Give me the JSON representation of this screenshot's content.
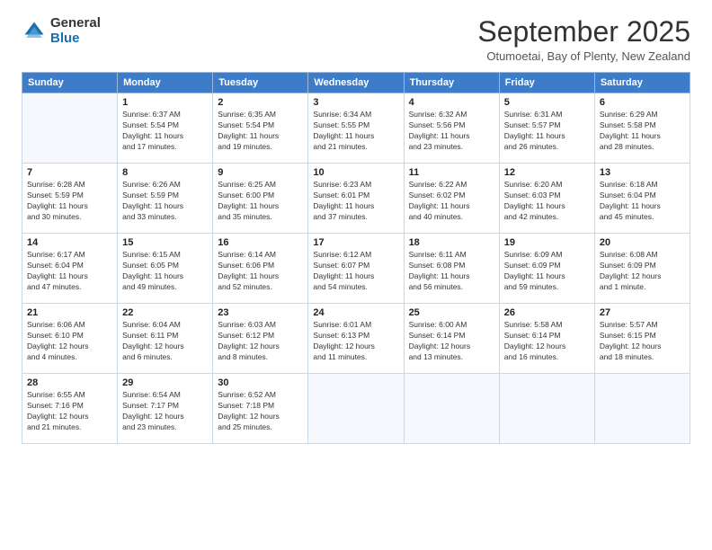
{
  "logo": {
    "line1": "General",
    "line2": "Blue"
  },
  "header": {
    "month": "September 2025",
    "location": "Otumoetai, Bay of Plenty, New Zealand"
  },
  "weekdays": [
    "Sunday",
    "Monday",
    "Tuesday",
    "Wednesday",
    "Thursday",
    "Friday",
    "Saturday"
  ],
  "weeks": [
    [
      {
        "day": "",
        "info": []
      },
      {
        "day": "1",
        "info": [
          "Sunrise: 6:37 AM",
          "Sunset: 5:54 PM",
          "Daylight: 11 hours",
          "and 17 minutes."
        ]
      },
      {
        "day": "2",
        "info": [
          "Sunrise: 6:35 AM",
          "Sunset: 5:54 PM",
          "Daylight: 11 hours",
          "and 19 minutes."
        ]
      },
      {
        "day": "3",
        "info": [
          "Sunrise: 6:34 AM",
          "Sunset: 5:55 PM",
          "Daylight: 11 hours",
          "and 21 minutes."
        ]
      },
      {
        "day": "4",
        "info": [
          "Sunrise: 6:32 AM",
          "Sunset: 5:56 PM",
          "Daylight: 11 hours",
          "and 23 minutes."
        ]
      },
      {
        "day": "5",
        "info": [
          "Sunrise: 6:31 AM",
          "Sunset: 5:57 PM",
          "Daylight: 11 hours",
          "and 26 minutes."
        ]
      },
      {
        "day": "6",
        "info": [
          "Sunrise: 6:29 AM",
          "Sunset: 5:58 PM",
          "Daylight: 11 hours",
          "and 28 minutes."
        ]
      }
    ],
    [
      {
        "day": "7",
        "info": [
          "Sunrise: 6:28 AM",
          "Sunset: 5:59 PM",
          "Daylight: 11 hours",
          "and 30 minutes."
        ]
      },
      {
        "day": "8",
        "info": [
          "Sunrise: 6:26 AM",
          "Sunset: 5:59 PM",
          "Daylight: 11 hours",
          "and 33 minutes."
        ]
      },
      {
        "day": "9",
        "info": [
          "Sunrise: 6:25 AM",
          "Sunset: 6:00 PM",
          "Daylight: 11 hours",
          "and 35 minutes."
        ]
      },
      {
        "day": "10",
        "info": [
          "Sunrise: 6:23 AM",
          "Sunset: 6:01 PM",
          "Daylight: 11 hours",
          "and 37 minutes."
        ]
      },
      {
        "day": "11",
        "info": [
          "Sunrise: 6:22 AM",
          "Sunset: 6:02 PM",
          "Daylight: 11 hours",
          "and 40 minutes."
        ]
      },
      {
        "day": "12",
        "info": [
          "Sunrise: 6:20 AM",
          "Sunset: 6:03 PM",
          "Daylight: 11 hours",
          "and 42 minutes."
        ]
      },
      {
        "day": "13",
        "info": [
          "Sunrise: 6:18 AM",
          "Sunset: 6:04 PM",
          "Daylight: 11 hours",
          "and 45 minutes."
        ]
      }
    ],
    [
      {
        "day": "14",
        "info": [
          "Sunrise: 6:17 AM",
          "Sunset: 6:04 PM",
          "Daylight: 11 hours",
          "and 47 minutes."
        ]
      },
      {
        "day": "15",
        "info": [
          "Sunrise: 6:15 AM",
          "Sunset: 6:05 PM",
          "Daylight: 11 hours",
          "and 49 minutes."
        ]
      },
      {
        "day": "16",
        "info": [
          "Sunrise: 6:14 AM",
          "Sunset: 6:06 PM",
          "Daylight: 11 hours",
          "and 52 minutes."
        ]
      },
      {
        "day": "17",
        "info": [
          "Sunrise: 6:12 AM",
          "Sunset: 6:07 PM",
          "Daylight: 11 hours",
          "and 54 minutes."
        ]
      },
      {
        "day": "18",
        "info": [
          "Sunrise: 6:11 AM",
          "Sunset: 6:08 PM",
          "Daylight: 11 hours",
          "and 56 minutes."
        ]
      },
      {
        "day": "19",
        "info": [
          "Sunrise: 6:09 AM",
          "Sunset: 6:09 PM",
          "Daylight: 11 hours",
          "and 59 minutes."
        ]
      },
      {
        "day": "20",
        "info": [
          "Sunrise: 6:08 AM",
          "Sunset: 6:09 PM",
          "Daylight: 12 hours",
          "and 1 minute."
        ]
      }
    ],
    [
      {
        "day": "21",
        "info": [
          "Sunrise: 6:06 AM",
          "Sunset: 6:10 PM",
          "Daylight: 12 hours",
          "and 4 minutes."
        ]
      },
      {
        "day": "22",
        "info": [
          "Sunrise: 6:04 AM",
          "Sunset: 6:11 PM",
          "Daylight: 12 hours",
          "and 6 minutes."
        ]
      },
      {
        "day": "23",
        "info": [
          "Sunrise: 6:03 AM",
          "Sunset: 6:12 PM",
          "Daylight: 12 hours",
          "and 8 minutes."
        ]
      },
      {
        "day": "24",
        "info": [
          "Sunrise: 6:01 AM",
          "Sunset: 6:13 PM",
          "Daylight: 12 hours",
          "and 11 minutes."
        ]
      },
      {
        "day": "25",
        "info": [
          "Sunrise: 6:00 AM",
          "Sunset: 6:14 PM",
          "Daylight: 12 hours",
          "and 13 minutes."
        ]
      },
      {
        "day": "26",
        "info": [
          "Sunrise: 5:58 AM",
          "Sunset: 6:14 PM",
          "Daylight: 12 hours",
          "and 16 minutes."
        ]
      },
      {
        "day": "27",
        "info": [
          "Sunrise: 5:57 AM",
          "Sunset: 6:15 PM",
          "Daylight: 12 hours",
          "and 18 minutes."
        ]
      }
    ],
    [
      {
        "day": "28",
        "info": [
          "Sunrise: 6:55 AM",
          "Sunset: 7:16 PM",
          "Daylight: 12 hours",
          "and 21 minutes."
        ]
      },
      {
        "day": "29",
        "info": [
          "Sunrise: 6:54 AM",
          "Sunset: 7:17 PM",
          "Daylight: 12 hours",
          "and 23 minutes."
        ]
      },
      {
        "day": "30",
        "info": [
          "Sunrise: 6:52 AM",
          "Sunset: 7:18 PM",
          "Daylight: 12 hours",
          "and 25 minutes."
        ]
      },
      {
        "day": "",
        "info": []
      },
      {
        "day": "",
        "info": []
      },
      {
        "day": "",
        "info": []
      },
      {
        "day": "",
        "info": []
      }
    ]
  ]
}
